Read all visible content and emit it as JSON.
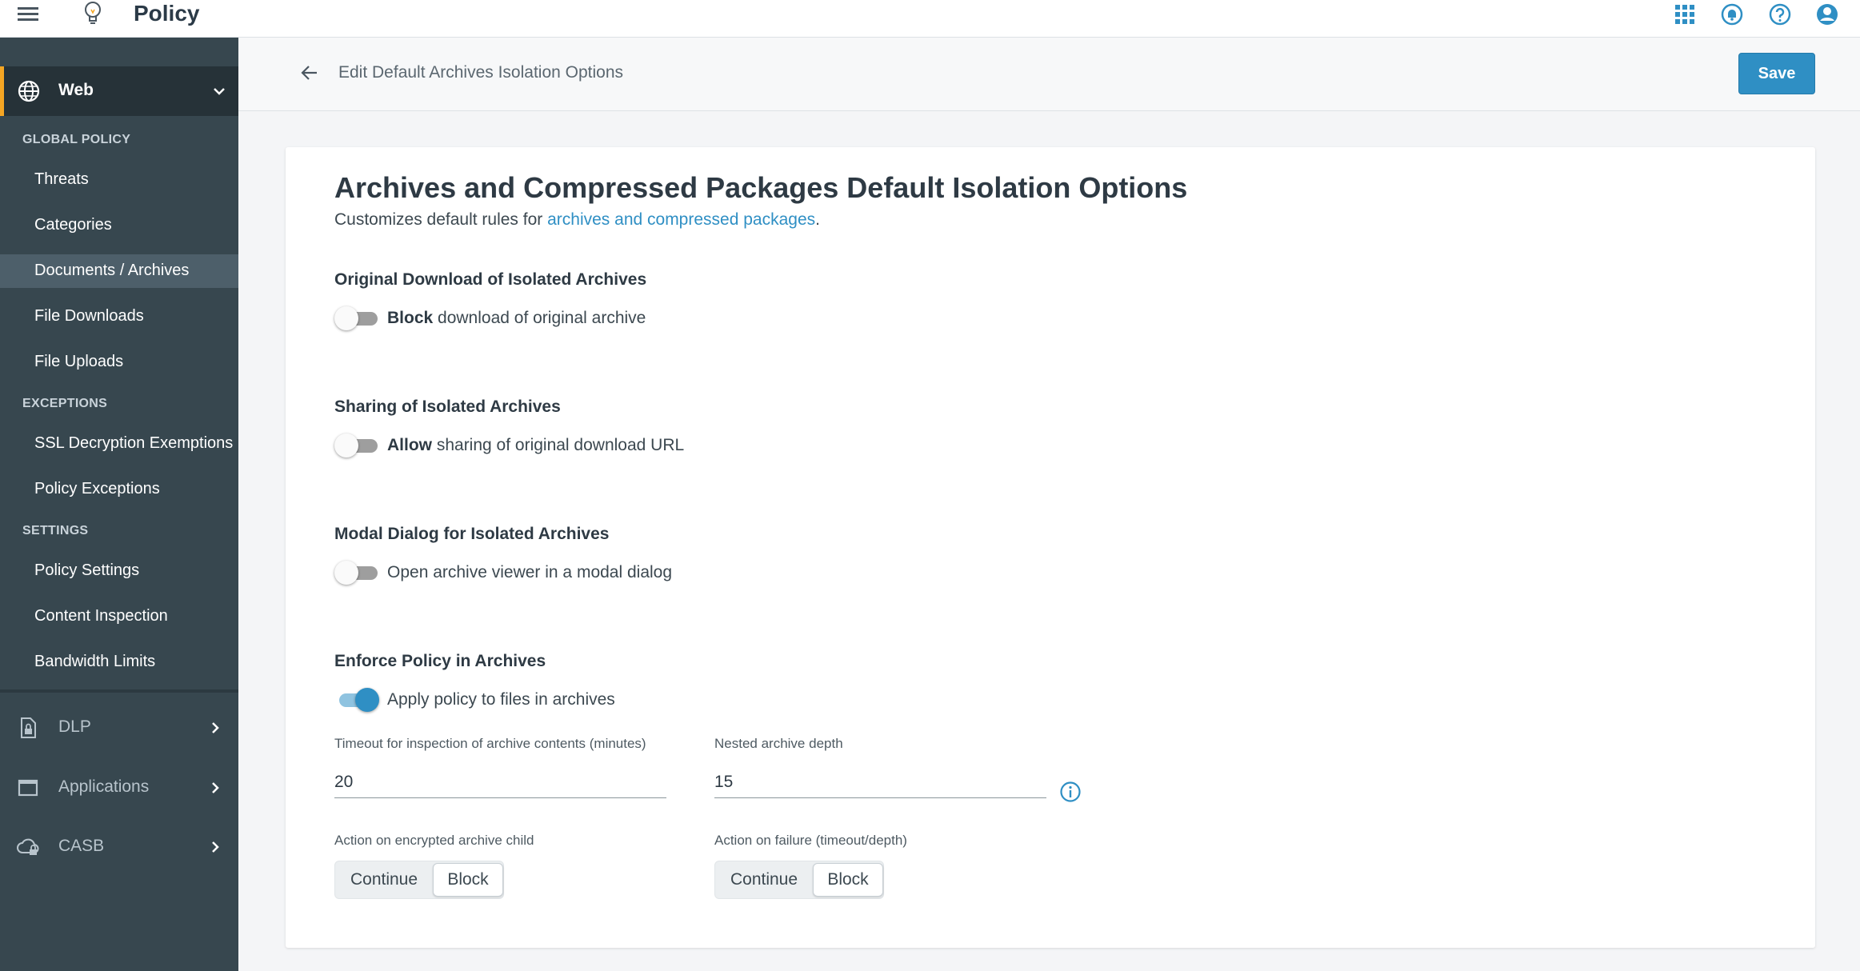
{
  "topbar": {
    "title": "Policy",
    "icons": [
      "menu-icon",
      "lightbulb-icon",
      "apps-grid-icon",
      "notifications-icon",
      "help-icon",
      "account-icon"
    ]
  },
  "sidebar": {
    "web": {
      "label": "Web"
    },
    "sections": [
      {
        "heading": "GLOBAL POLICY",
        "items": [
          "Threats",
          "Categories",
          "Documents / Archives",
          "File Downloads",
          "File Uploads"
        ]
      },
      {
        "heading": "EXCEPTIONS",
        "items": [
          "SSL Decryption Exemptions",
          "Policy Exceptions"
        ]
      },
      {
        "heading": "SETTINGS",
        "items": [
          "Policy Settings",
          "Content Inspection",
          "Bandwidth Limits"
        ]
      }
    ],
    "active_item": "Documents / Archives",
    "main_items": [
      {
        "label": "DLP",
        "icon": "dlp-document-icon"
      },
      {
        "label": "Applications",
        "icon": "applications-window-icon"
      },
      {
        "label": "CASB",
        "icon": "casb-cloud-icon"
      }
    ]
  },
  "header": {
    "breadcrumb": "Edit Default Archives Isolation Options",
    "save_label": "Save"
  },
  "card": {
    "title": "Archives and Compressed Packages Default Isolation Options",
    "desc_prefix": "Customizes default rules for ",
    "desc_link": "archives and compressed packages",
    "desc_suffix": ".",
    "options": [
      {
        "heading": "Original Download of Isolated Archives",
        "bold": "Block",
        "text": " download of original archive",
        "on": false
      },
      {
        "heading": "Sharing of Isolated Archives",
        "bold": "Allow",
        "text": " sharing of original download URL",
        "on": false
      },
      {
        "heading": "Modal Dialog for Isolated Archives",
        "bold": "",
        "text": "Open archive viewer in a modal dialog",
        "on": false
      },
      {
        "heading": "Enforce Policy in Archives",
        "bold": "",
        "text": "Apply policy to files in archives",
        "on": true
      }
    ],
    "timeout": {
      "label": "Timeout for inspection of archive contents (minutes)",
      "value": "20"
    },
    "depth": {
      "label": "Nested archive depth",
      "value": "15"
    },
    "encrypted_action": {
      "label": "Action on encrypted archive child",
      "options": [
        "Continue",
        "Block"
      ],
      "selected": "Block"
    },
    "failure_action": {
      "label": "Action on failure (timeout/depth)",
      "options": [
        "Continue",
        "Block"
      ],
      "selected": "Block"
    }
  },
  "colors": {
    "accent": "#2f8fc4",
    "sidebar_bg": "#37474f",
    "sidebar_active_bg": "#263238",
    "indicator": "#f5a623"
  }
}
